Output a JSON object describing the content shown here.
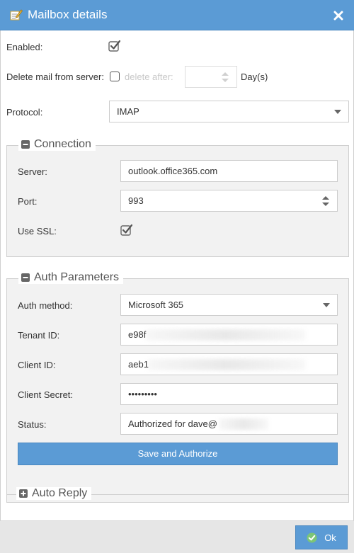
{
  "dialog": {
    "title": "Mailbox details",
    "close_icon": "close-icon",
    "title_icon": "edit-note-icon"
  },
  "general": {
    "enabled_label": "Enabled:",
    "enabled_checked": true,
    "delete_label": "Delete mail from server:",
    "delete_checked": false,
    "delete_after_label": "delete after:",
    "delete_after_value": "",
    "days_label": "Day(s)",
    "protocol_label": "Protocol:",
    "protocol_value": "IMAP"
  },
  "connection": {
    "legend": "Connection",
    "server_label": "Server:",
    "server_value": "outlook.office365.com",
    "port_label": "Port:",
    "port_value": "993",
    "ssl_label": "Use SSL:",
    "ssl_checked": true
  },
  "auth": {
    "legend": "Auth Parameters",
    "method_label": "Auth method:",
    "method_value": "Microsoft 365",
    "tenant_label": "Tenant ID:",
    "tenant_value": "e98f",
    "client_label": "Client ID:",
    "client_value": "aeb1",
    "secret_label": "Client Secret:",
    "secret_value": "•••••••••",
    "status_label": "Status:",
    "status_value": "Authorized for dave@",
    "authorize_button": "Save and Authorize"
  },
  "auto_reply": {
    "legend": "Auto Reply",
    "collapsed": true
  },
  "footer": {
    "ok_label": "Ok"
  },
  "colors": {
    "accent": "#5b9bd5",
    "footer_bg": "#e6e6e6",
    "fieldset_bg": "#f2f2f2"
  }
}
